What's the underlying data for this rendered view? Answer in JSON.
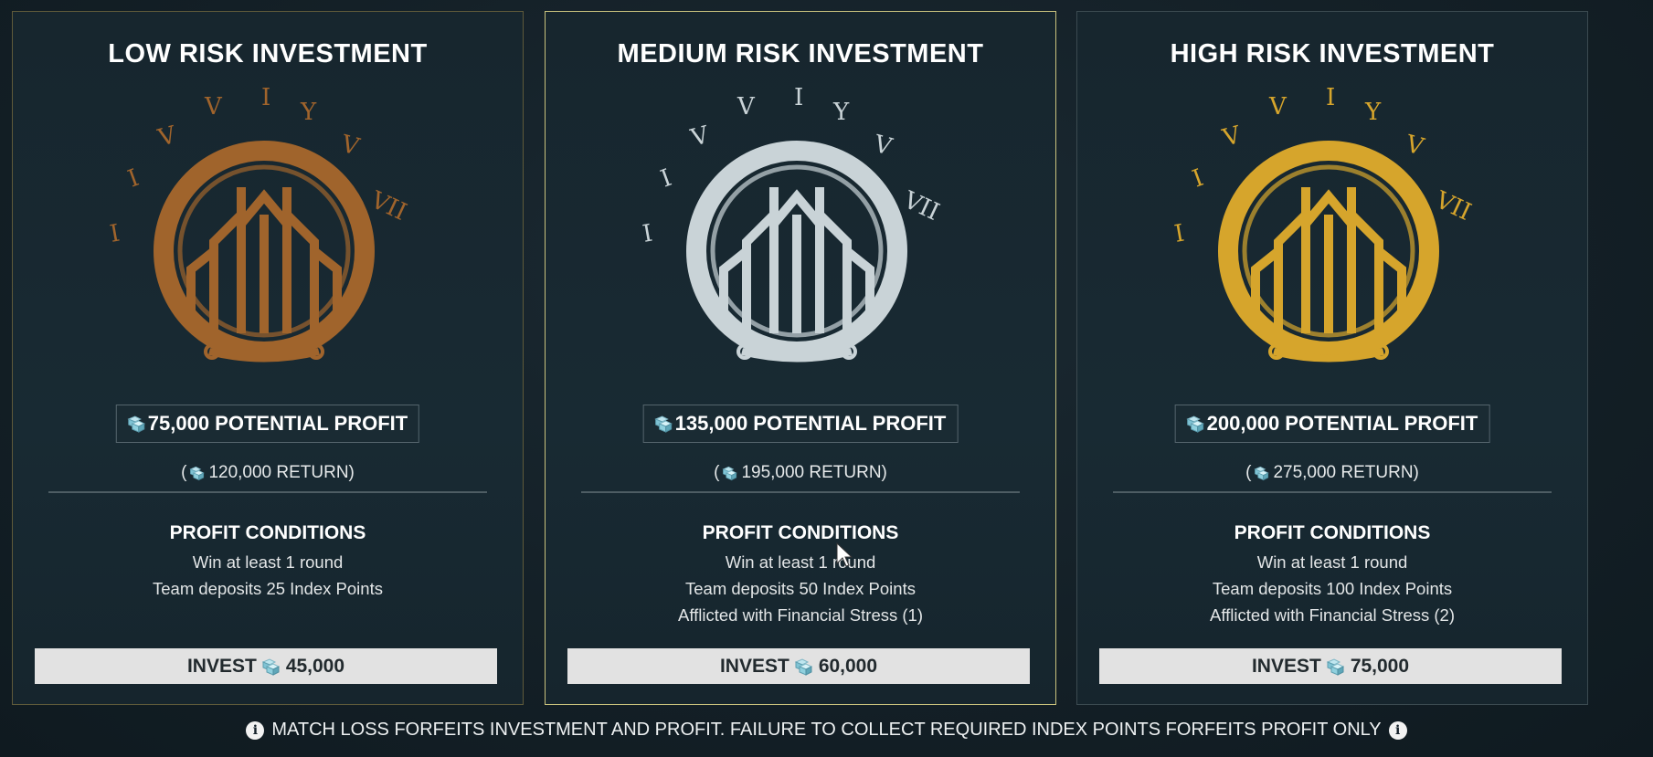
{
  "colors": {
    "bronze": "#a0642c",
    "silver": "#c9d3d7",
    "gold": "#d6a52c",
    "selected_border": "#c9c27d",
    "button_bg": "#e2e2e2"
  },
  "cards": [
    {
      "title": "LOW RISK INVESTMENT",
      "emblem": "bronze-emblem-icon",
      "profit": "75,000 POTENTIAL PROFIT",
      "return_open": "(",
      "return_text": "120,000 RETURN)",
      "conditions_title": "PROFIT CONDITIONS",
      "conditions": [
        "Win at least 1 round",
        "Team deposits 25 Index Points"
      ],
      "invest_label": "INVEST",
      "invest_amount": "45,000"
    },
    {
      "title": "MEDIUM RISK INVESTMENT",
      "emblem": "silver-emblem-icon",
      "profit": "135,000 POTENTIAL PROFIT",
      "return_open": "(",
      "return_text": "195,000 RETURN)",
      "conditions_title": "PROFIT CONDITIONS",
      "conditions": [
        "Win at least 1 round",
        "Team deposits 50 Index Points",
        "Afflicted with Financial Stress (1)"
      ],
      "invest_label": "INVEST",
      "invest_amount": "60,000"
    },
    {
      "title": "HIGH RISK INVESTMENT",
      "emblem": "gold-emblem-icon",
      "profit": "200,000 POTENTIAL PROFIT",
      "return_open": "(",
      "return_text": "275,000 RETURN)",
      "conditions_title": "PROFIT CONDITIONS",
      "conditions": [
        "Win at least 1 round",
        "Team deposits 100 Index Points",
        "Afflicted with Financial Stress (2)"
      ],
      "invest_label": "INVEST",
      "invest_amount": "75,000"
    }
  ],
  "footer": {
    "text": "MATCH LOSS FORFEITS INVESTMENT AND PROFIT. FAILURE TO COLLECT REQUIRED INDEX POINTS FORFEITS PROFIT ONLY",
    "info_glyph": "i",
    "icon": "info-icon"
  }
}
